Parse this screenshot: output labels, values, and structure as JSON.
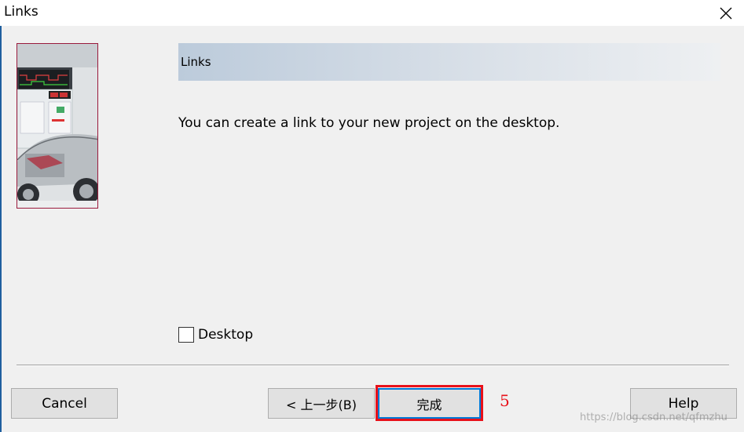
{
  "window": {
    "title": "Links"
  },
  "header": {
    "title": "Links"
  },
  "content": {
    "description": "You can create a link to your new project on the desktop."
  },
  "options": {
    "desktop_label": "Desktop",
    "desktop_checked": false
  },
  "buttons": {
    "cancel": "Cancel",
    "back": "< 上一步(B)",
    "finish": "完成",
    "help": "Help"
  },
  "annotation": {
    "step_number": "5"
  },
  "watermark": "https://blog.csdn.net/qfmzhu",
  "icons": {
    "close": "close-icon",
    "wizard_image": "car-dashboard-image"
  },
  "colors": {
    "highlight": "#e8111a",
    "focus": "#0078d7",
    "image_border": "#9a1a3c"
  }
}
